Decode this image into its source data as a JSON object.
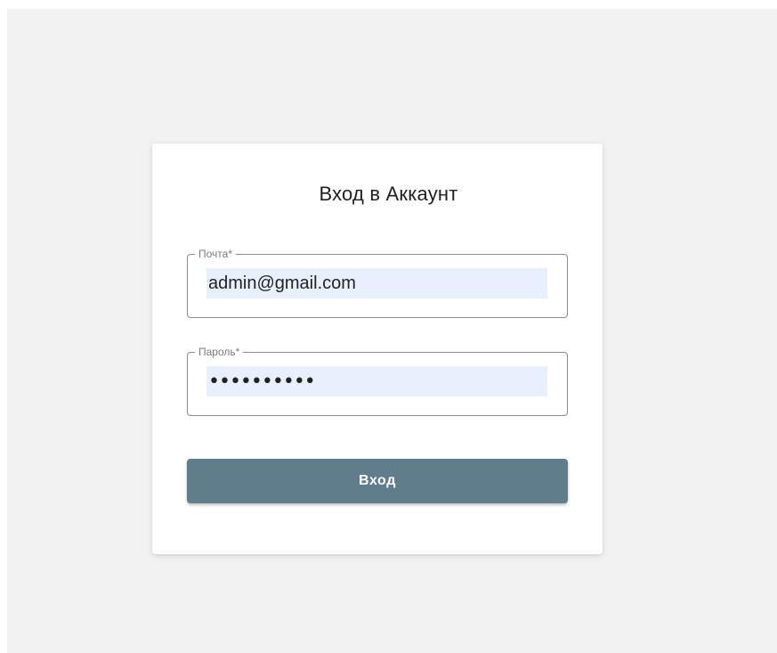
{
  "login_form": {
    "title": "Вход в Аккаунт",
    "email": {
      "label": "Почта*",
      "value": "admin@gmail.com"
    },
    "password": {
      "label": "Пароль*",
      "masked_value": "••••••••••"
    },
    "submit_label": "Вход"
  },
  "colors": {
    "page_background": "#f2f2f2",
    "card_background": "#ffffff",
    "autofill_background": "#e8f0fe",
    "button_background": "#607d8b",
    "button_text": "#ffffff"
  }
}
